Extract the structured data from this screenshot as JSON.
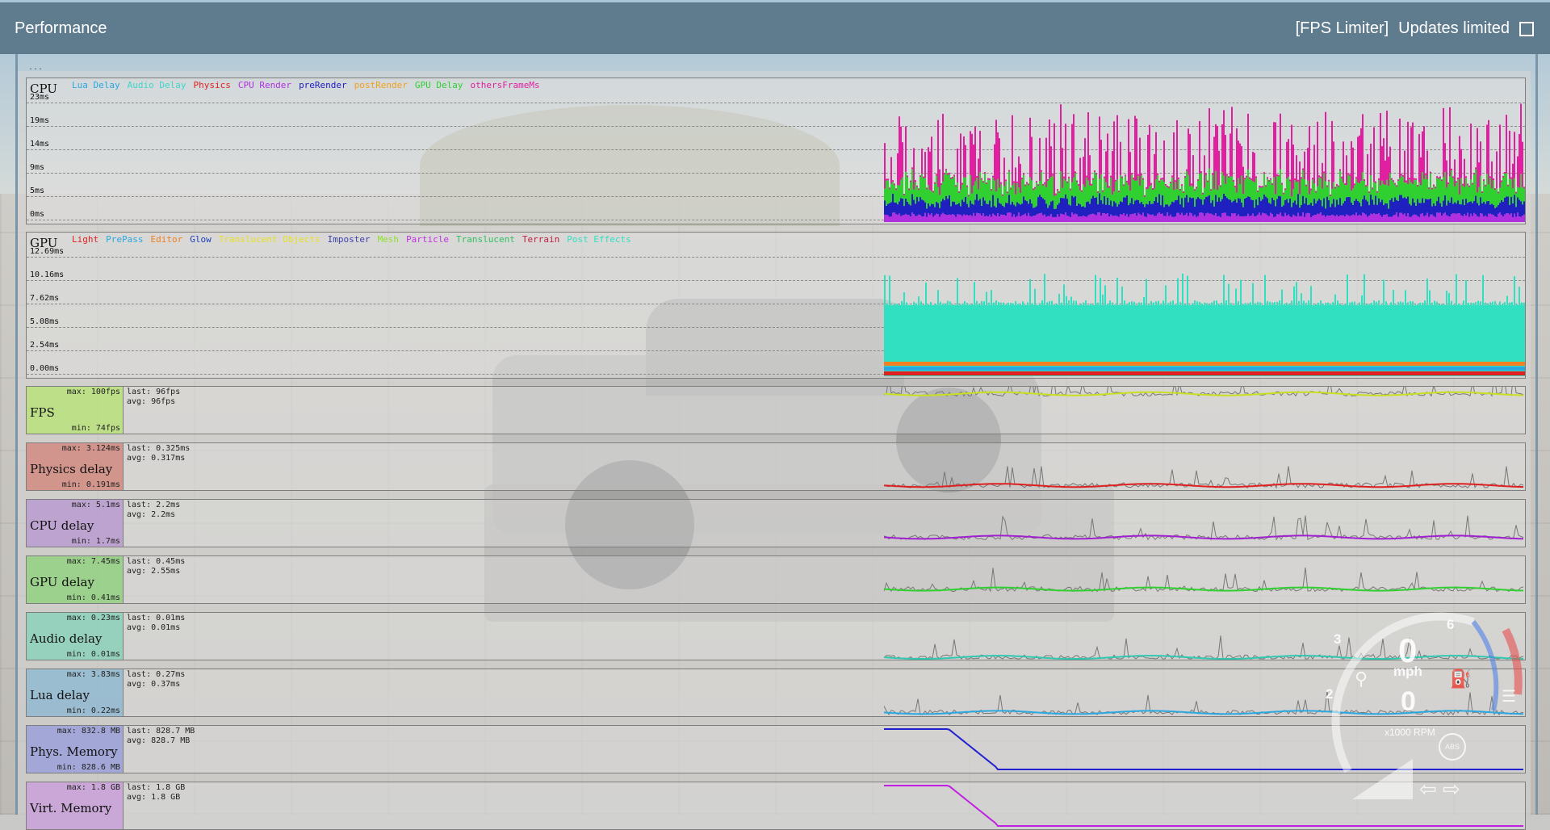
{
  "window": {
    "title": "Performance",
    "fps_limiter_label": "[FPS Limiter]",
    "updates_label": "Updates limited",
    "updates_checked": false,
    "ellipsis": "..."
  },
  "cpu_graph": {
    "label": "CPU",
    "legend": [
      {
        "name": "Lua Delay",
        "color": "#2aa8e0"
      },
      {
        "name": "Audio Delay",
        "color": "#3fd6c8"
      },
      {
        "name": "Physics",
        "color": "#e02020"
      },
      {
        "name": "CPU Render",
        "color": "#b030e0"
      },
      {
        "name": "preRender",
        "color": "#2020c0"
      },
      {
        "name": "postRender",
        "color": "#f0a020"
      },
      {
        "name": "GPU Delay",
        "color": "#30d030"
      },
      {
        "name": "othersFrameMs",
        "color": "#e020a0"
      }
    ],
    "ticks": [
      "23ms",
      "19ms",
      "14ms",
      "9ms",
      "5ms",
      "0ms"
    ]
  },
  "gpu_graph": {
    "label": "GPU",
    "legend": [
      {
        "name": "Light",
        "color": "#e02020"
      },
      {
        "name": "PrePass",
        "color": "#2aa8e0"
      },
      {
        "name": "Editor",
        "color": "#f08020"
      },
      {
        "name": "Glow",
        "color": "#2040c0"
      },
      {
        "name": "Translucent Objects",
        "color": "#e8e020"
      },
      {
        "name": "Imposter",
        "color": "#4040b0"
      },
      {
        "name": "Mesh",
        "color": "#90e030"
      },
      {
        "name": "Particle",
        "color": "#c030e0"
      },
      {
        "name": "Translucent",
        "color": "#30c060"
      },
      {
        "name": "Terrain",
        "color": "#c02040"
      },
      {
        "name": "Post Effects",
        "color": "#30e0c0"
      }
    ],
    "ticks": [
      "12.69ms",
      "10.16ms",
      "7.62ms",
      "5.08ms",
      "2.54ms",
      "0.00ms"
    ]
  },
  "metrics": [
    {
      "name": "FPS",
      "max": "max: 100fps",
      "min": "min: 74fps",
      "last": "last: 96fps",
      "avg": "avg: 96fps",
      "color": "#b8e07a",
      "line": "#c8e020",
      "level": 0.85
    },
    {
      "name": "Physics delay",
      "max": "max: 3.124ms",
      "min": "min: 0.191ms",
      "last": "last: 0.325ms",
      "avg": "avg: 0.317ms",
      "color": "#d08a80",
      "line": "#e02020",
      "level": 0.1
    },
    {
      "name": "CPU delay",
      "max": "max: 5.1ms",
      "min": "min: 1.7ms",
      "last": "last: 2.2ms",
      "avg": "avg: 2.2ms",
      "color": "#b89ad0",
      "line": "#a020d0",
      "level": 0.2
    },
    {
      "name": "GPU delay",
      "max": "max: 7.45ms",
      "min": "min: 0.41ms",
      "last": "last: 0.45ms",
      "avg": "avg: 2.55ms",
      "color": "#90d080",
      "line": "#30d030",
      "level": 0.3
    },
    {
      "name": "Audio delay",
      "max": "max: 0.23ms",
      "min": "min: 0.01ms",
      "last": "last: 0.01ms",
      "avg": "avg: 0.01ms",
      "color": "#8ad0b8",
      "line": "#30c8b0",
      "level": 0.05
    },
    {
      "name": "Lua delay",
      "max": "max: 3.83ms",
      "min": "min: 0.22ms",
      "last": "last: 0.27ms",
      "avg": "avg: 0.37ms",
      "color": "#90b8d0",
      "line": "#2aa8e0",
      "level": 0.08
    },
    {
      "name": "Phys. Memory",
      "max": "max: 832.8 MB",
      "min": "min: 828.6 MB",
      "last": "last: 828.7 MB",
      "avg": "avg: 828.7 MB",
      "color": "#9aa0d8",
      "line": "#2020d0",
      "level": 0.05
    },
    {
      "name": "Virt. Memory",
      "max": "max: 1.8 GB",
      "min": "",
      "last": "last: 1.8 GB",
      "avg": "avg: 1.8 GB",
      "color": "#c8a0d8",
      "line": "#c020e0",
      "level": 0.05
    }
  ],
  "dashboard": {
    "speed_unit": "mph",
    "rpm_label": "x1000 RPM",
    "gear_marks": [
      "2",
      "3",
      "6"
    ],
    "abs_label": "ABS",
    "speed_value": "0",
    "gear_value": "0"
  }
}
